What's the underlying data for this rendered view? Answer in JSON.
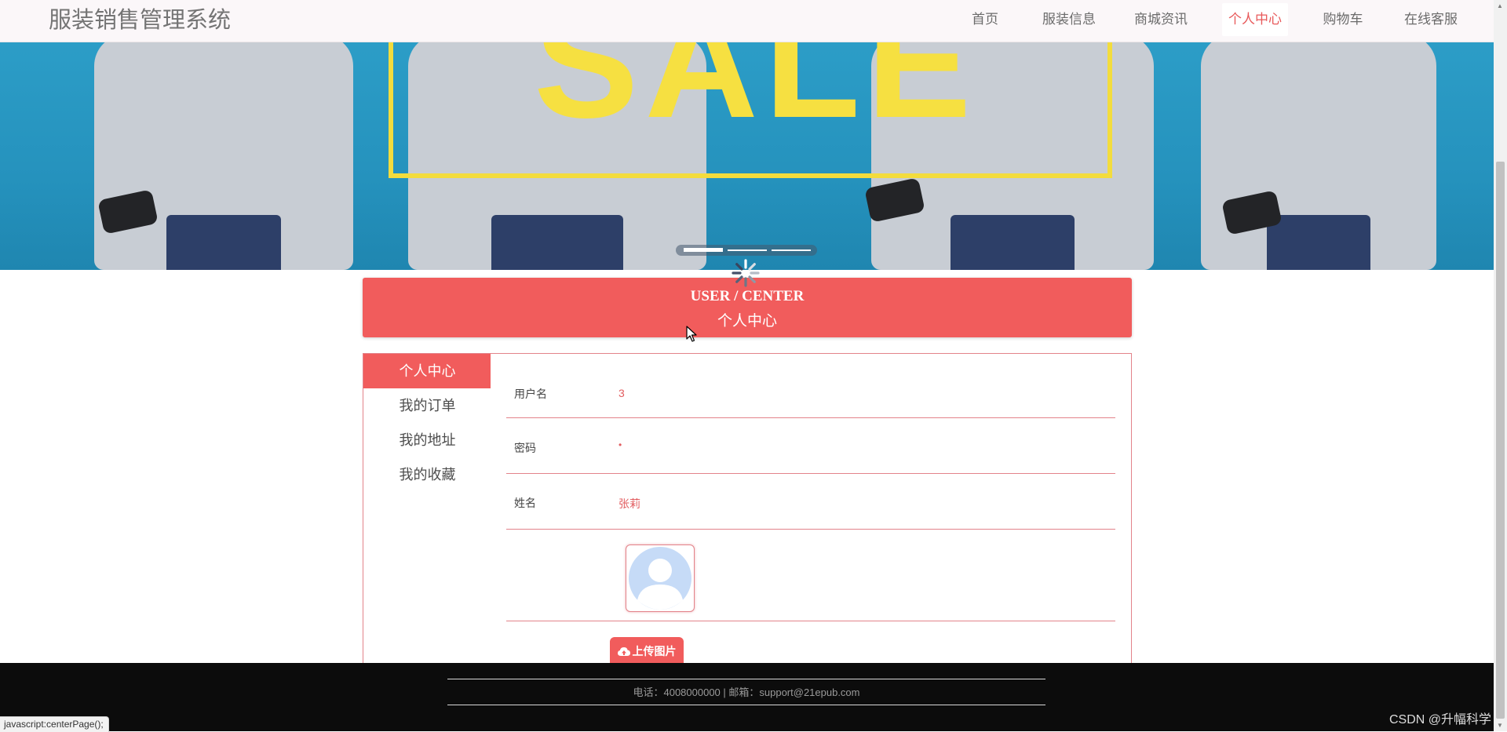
{
  "header": {
    "site_title": "服装销售管理系统",
    "nav": [
      {
        "label": "首页"
      },
      {
        "label": "服装信息"
      },
      {
        "label": "商城资讯"
      },
      {
        "label": "个人中心",
        "active": true
      },
      {
        "label": "购物车"
      },
      {
        "label": "在线客服"
      }
    ]
  },
  "banner": {
    "sale_text": "SALE",
    "carousel_slides": 3,
    "active_slide": 1
  },
  "center_header": {
    "title_en": "USER / CENTER",
    "title_zh": "个人中心"
  },
  "sidebar": {
    "items": [
      {
        "label": "个人中心",
        "active": true
      },
      {
        "label": "我的订单"
      },
      {
        "label": "我的地址"
      },
      {
        "label": "我的收藏"
      }
    ]
  },
  "profile": {
    "username_label": "用户名",
    "username_value": "3",
    "password_label": "密码",
    "password_value": "•",
    "name_label": "姓名",
    "name_value": "张莉",
    "upload_label": "上传图片"
  },
  "footer": {
    "contact": "电话：4008000000 | 邮箱：support@21epub.com"
  },
  "status_bar": {
    "url": "javascript:centerPage();"
  },
  "watermark": "CSDN @升幅科学",
  "icons": {
    "avatar": "user-avatar-placeholder-icon",
    "upload": "cloud-upload-icon",
    "loading": "loading-spinner-icon",
    "cursor": "mouse-cursor-icon"
  },
  "colors": {
    "accent": "#f15c5c",
    "accent_text": "#e25d60",
    "border": "#e3838a",
    "header_bg": "#fbf7f9",
    "banner_bg": "#2596c1",
    "sale_yellow": "#f6e041",
    "footer_bg": "#0c0c0c"
  }
}
